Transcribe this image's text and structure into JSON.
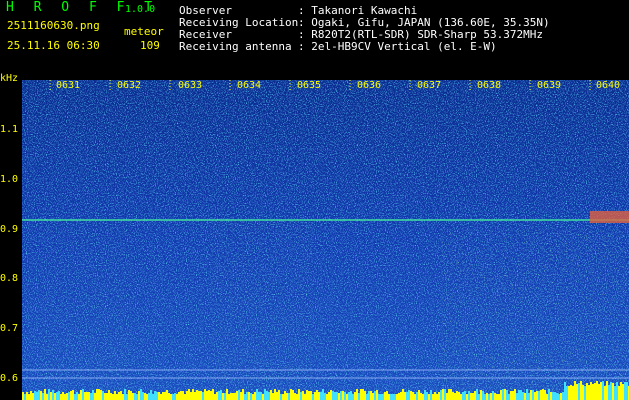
{
  "header": {
    "app_title": "H R O F F T",
    "app_version": "1.0.0",
    "filename": "2511160630.png",
    "datetime": "25.11.16 06:30",
    "meteor_label": "meteor",
    "meteor_count": "109",
    "info": [
      {
        "key": "Observer",
        "value": ": Takanori Kawachi"
      },
      {
        "key": "Receiving Location",
        "value": ": Ogaki, Gifu, JAPAN (136.60E, 35.35N)"
      },
      {
        "key": "Receiver",
        "value": ": R820T2(RTL-SDR) SDR-Sharp 53.372MHz"
      },
      {
        "key": "Receiving antenna",
        "value": ": 2el-HB9CV Vertical (el. E-W)"
      }
    ]
  },
  "spectrogram": {
    "y_unit": "kHz",
    "y_ticks": [
      "1.1",
      "1.0",
      "0.9",
      "0.8",
      "0.7",
      "0.6"
    ],
    "x_ticks": [
      "0631",
      "0632",
      "0633",
      "0634",
      "0635",
      "0636",
      "0637",
      "0638",
      "0639",
      "0640"
    ],
    "colors": {
      "background": "#1030a8",
      "tick_text": "#ffff00",
      "carrier_line": "#40e0a0"
    }
  }
}
